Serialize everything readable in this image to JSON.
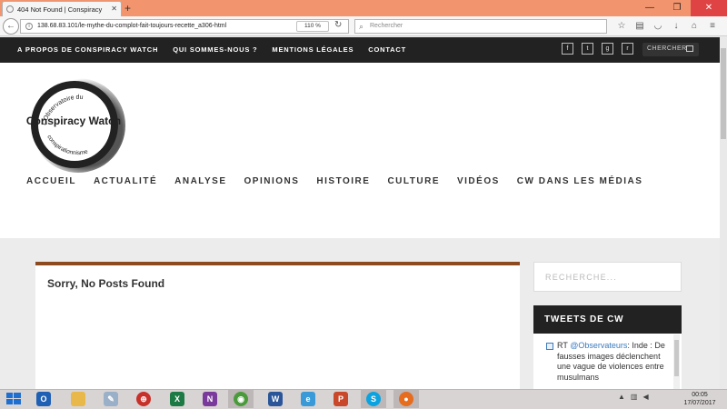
{
  "browser": {
    "tab_title": "404 Not Found | Conspiracy",
    "url": "138.68.83.101/le-mythe-du-complot-fait-toujours-recette_a306-html",
    "zoom": "110 %",
    "search_placeholder": "Rechercher"
  },
  "topbar": {
    "links": [
      "A PROPOS DE CONSPIRACY WATCH",
      "QUI SOMMES-NOUS ?",
      "MENTIONS LÉGALES",
      "CONTACT"
    ],
    "search_label": "CHERCHER"
  },
  "logo": {
    "main": "Conspiracy Watch",
    "ring_top": "L'Observatoire du",
    "ring_bottom": "conspirationnisme"
  },
  "mainnav": [
    "ACCUEIL",
    "ACTUALITÉ",
    "ANALYSE",
    "OPINIONS",
    "HISTOIRE",
    "CULTURE",
    "VIDÉOS",
    "CW DANS LES MÉDIAS"
  ],
  "content": {
    "title": "Sorry, No Posts Found"
  },
  "sidebar": {
    "search_placeholder": "RECHERCHE...",
    "tweets_title": "TWEETS DE CW",
    "tweet": {
      "prefix": "RT",
      "handle": "@Observateurs",
      "text": ": Inde : De fausses images déclenchent une vague de violences entre musulmans"
    }
  },
  "taskbar": {
    "time": "00:05",
    "date": "17/07/2017"
  },
  "colors": {
    "accent": "#8c4a1e",
    "dark": "#222222",
    "tab_strip": "#f2956e",
    "link": "#3b7bbf"
  }
}
